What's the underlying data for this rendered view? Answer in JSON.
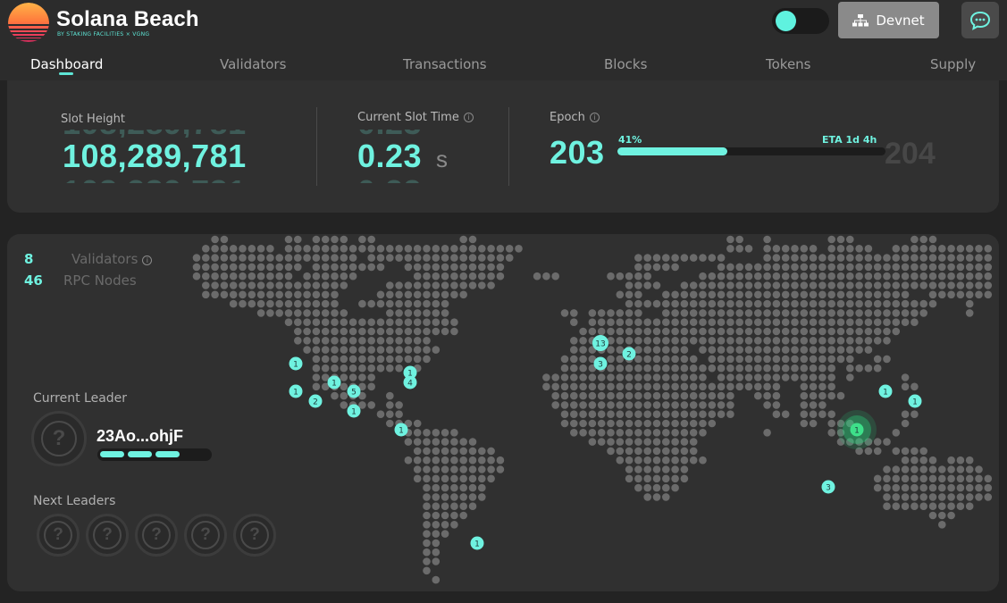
{
  "header": {
    "brand_title": "Solana Beach",
    "brand_sub": "BY STAKING FACILITIES × VGNG",
    "network_label": "Devnet",
    "theme_toggle_on": true,
    "icons": {
      "network": "network-icon",
      "chat": "chat-icon"
    },
    "accent_color": "#6ff2e0"
  },
  "nav": {
    "items": [
      {
        "label": "Dashboard",
        "active": true
      },
      {
        "label": "Validators",
        "active": false
      },
      {
        "label": "Transactions",
        "active": false
      },
      {
        "label": "Blocks",
        "active": false
      },
      {
        "label": "Tokens",
        "active": false
      },
      {
        "label": "Supply",
        "active": false
      }
    ]
  },
  "stats": {
    "slot_height": {
      "label": "Slot Height",
      "value": "108,289,781"
    },
    "slot_time": {
      "label": "Current Slot Time",
      "value": "0.23",
      "unit": "s"
    },
    "epoch": {
      "label": "Epoch",
      "current": "203",
      "next": "204",
      "progress_label": "41%",
      "progress": 0.41,
      "eta": "ETA 1d 4h"
    }
  },
  "map": {
    "validators": {
      "count": "8",
      "label": "Validators"
    },
    "rpc_nodes": {
      "count": "46",
      "label": "RPC Nodes"
    },
    "current_leader": {
      "label": "Current Leader",
      "name": "23Ao...ohjF",
      "slots_done": 3,
      "slots_total": 4
    },
    "next_leaders": {
      "label": "Next Leaders",
      "count": 5
    },
    "markers": [
      {
        "count": "1"
      },
      {
        "count": "1"
      },
      {
        "count": "1"
      },
      {
        "count": "2"
      },
      {
        "count": "5"
      },
      {
        "count": "1"
      },
      {
        "count": "1"
      },
      {
        "count": "4"
      },
      {
        "count": "1"
      },
      {
        "count": "13"
      },
      {
        "count": "3"
      },
      {
        "count": "2"
      },
      {
        "count": "1"
      },
      {
        "count": "1"
      },
      {
        "count": "1",
        "highlight": true
      },
      {
        "count": "3"
      },
      {
        "count": "1"
      }
    ]
  }
}
